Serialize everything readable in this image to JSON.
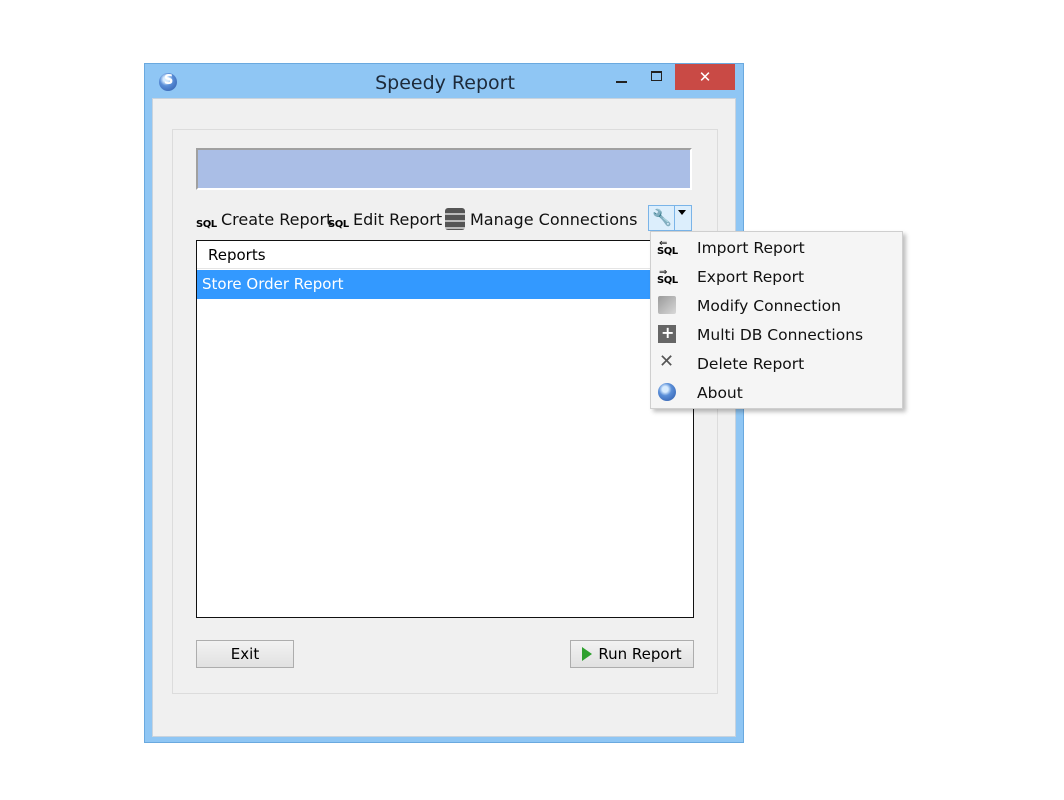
{
  "window": {
    "title": "Speedy Report",
    "close_glyph": "✕"
  },
  "toolbar": {
    "create_report": "Create Report",
    "edit_report": "Edit Report",
    "manage_connections": "Manage Connections",
    "sql_badge": "SQL",
    "tools_icon": "🔧"
  },
  "reports_list": {
    "header": "Reports",
    "rows": [
      "Store Order Report"
    ]
  },
  "buttons": {
    "exit": "Exit",
    "run_report": "Run Report"
  },
  "menu": {
    "items": [
      {
        "label": "Import Report",
        "icon": "import-sql-icon"
      },
      {
        "label": "Export Report",
        "icon": "export-sql-icon"
      },
      {
        "label": "Modify Connection",
        "icon": "modify-connection-icon"
      },
      {
        "label": "Multi DB Connections",
        "icon": "multi-db-icon"
      },
      {
        "label": "Delete Report",
        "icon": "delete-icon"
      },
      {
        "label": "About",
        "icon": "about-icon"
      }
    ]
  },
  "colors": {
    "frame": "#8fc6f4",
    "selection": "#3399ff",
    "close": "#c94a45",
    "status_bar": "#aabee6"
  }
}
